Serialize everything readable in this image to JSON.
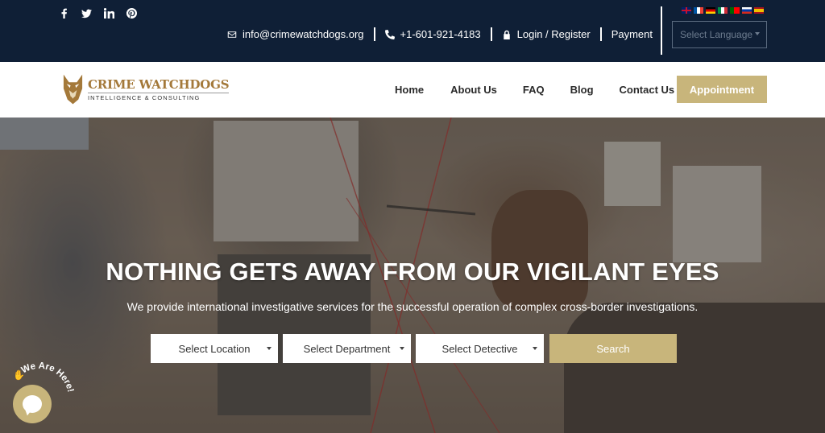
{
  "topbar": {
    "social": [
      "facebook-icon",
      "twitter-icon",
      "linkedin-icon",
      "pinterest-icon"
    ],
    "email": "info@crimewatchdogs.org",
    "phone": "+1-601-921-4183",
    "login": "Login / Register",
    "payment": "Payment",
    "language_placeholder": "Select Language",
    "flags": [
      "uk-flag-icon",
      "france-flag-icon",
      "germany-flag-icon",
      "italy-flag-icon",
      "portugal-flag-icon",
      "russia-flag-icon",
      "spain-flag-icon"
    ]
  },
  "logo": {
    "title": "CRIME WATCHDOGS",
    "subtitle": "INTELLIGENCE & CONSULTING"
  },
  "nav": {
    "items": [
      "Home",
      "About Us",
      "FAQ",
      "Blog",
      "Contact Us"
    ],
    "appointment": "Appointment"
  },
  "hero": {
    "title": "NOTHING GETS AWAY FROM OUR VIGILANT EYES",
    "subtitle": "We provide international investigative services for the successful operation of complex cross-border investigations.",
    "location": "Select Location",
    "department": "Select Department",
    "detective": "Select Detective",
    "search": "Search"
  },
  "chat": {
    "label": "We Are Here!"
  },
  "colors": {
    "topbar_bg": "#0f1f36",
    "accent": "#c8b57b",
    "logo_brown": "#a4793a"
  }
}
